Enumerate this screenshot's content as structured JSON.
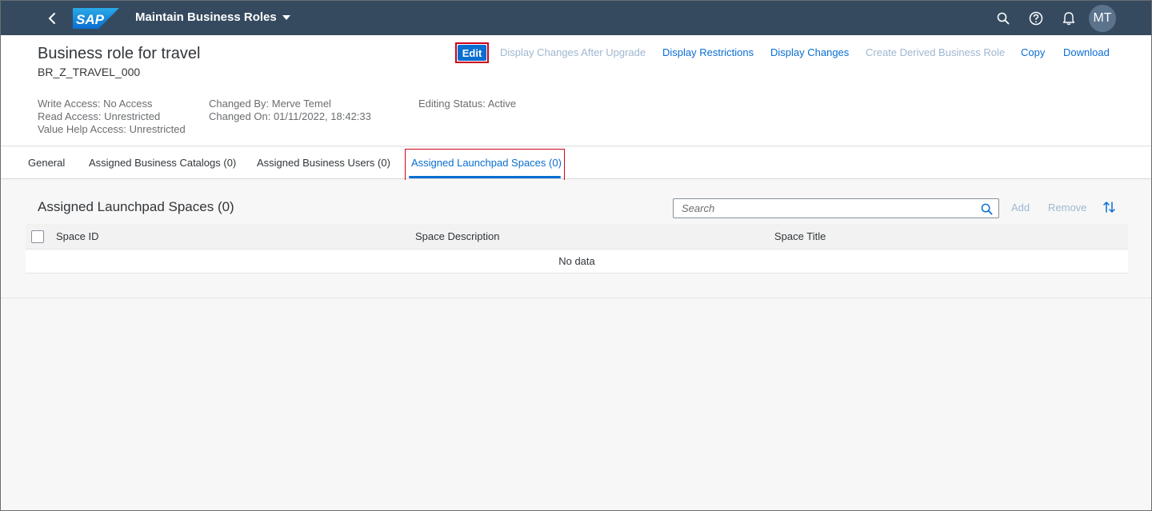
{
  "shell": {
    "logo_text": "SAP",
    "app_title": "Maintain Business Roles",
    "avatar_initials": "MT"
  },
  "header": {
    "title": "Business role for travel",
    "subtitle": "BR_Z_TRAVEL_000",
    "attributes": {
      "write_access": "Write Access: No Access",
      "read_access": "Read Access: Unrestricted",
      "value_help_access": "Value Help Access: Unrestricted",
      "changed_by": "Changed By: Merve Temel",
      "changed_on": "Changed On: 01/11/2022, 18:42:33",
      "editing_status": "Editing Status: Active"
    },
    "actions": {
      "edit": "Edit",
      "display_changes_after_upgrade": "Display Changes After Upgrade",
      "display_restrictions": "Display Restrictions",
      "display_changes": "Display Changes",
      "create_derived": "Create Derived Business Role",
      "copy": "Copy",
      "download": "Download"
    }
  },
  "tabs": {
    "general": "General",
    "catalogs": "Assigned Business Catalogs (0)",
    "users": "Assigned Business Users (0)",
    "spaces": "Assigned Launchpad Spaces (0)"
  },
  "section": {
    "title": "Assigned Launchpad Spaces (0)",
    "search_placeholder": "Search",
    "add": "Add",
    "remove": "Remove",
    "columns": {
      "space_id": "Space ID",
      "space_description": "Space Description",
      "space_title": "Space Title"
    },
    "no_data": "No data"
  },
  "colors": {
    "shell_bg": "#354a5f",
    "accent": "#0a6ed1",
    "highlight": "#d0021b"
  }
}
